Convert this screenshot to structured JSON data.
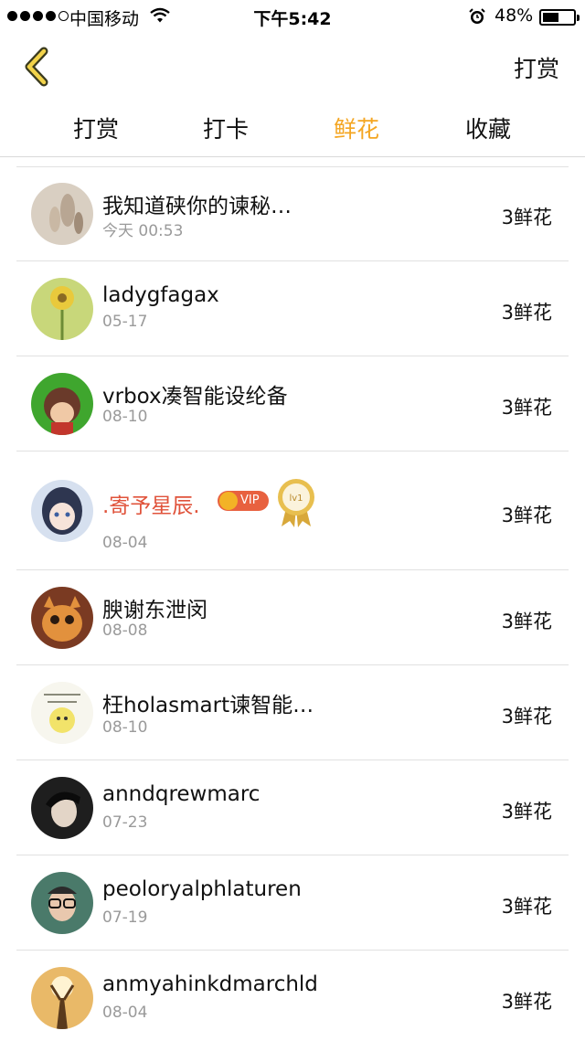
{
  "status_bar": {
    "carrier": "中国移动",
    "time": "下午5:42",
    "battery": "48%"
  },
  "nav": {
    "right_label": "打赏"
  },
  "tabs": [
    {
      "label": "打赏",
      "active": false
    },
    {
      "label": "打卡",
      "active": false
    },
    {
      "label": "鲜花",
      "active": true
    },
    {
      "label": "收藏",
      "active": false
    }
  ],
  "colors": {
    "accent": "#f4a622",
    "vip_name": "#e0533b"
  },
  "list": [
    {
      "name": "我知道硖你的谏秘…",
      "date": "今天 00:53",
      "count": "3鲜花"
    },
    {
      "name": "ladygfagax",
      "date": "05-17",
      "count": "3鲜花"
    },
    {
      "name": "vrbox凑智能设纶备",
      "date": "08-10",
      "count": "3鲜花"
    },
    {
      "name": ".寄予星辰.",
      "date": "08-04",
      "count": "3鲜花",
      "vip": true,
      "vip_label": "VIP",
      "medal_label": "lv1"
    },
    {
      "name": "腴谢东泄闵",
      "date": "08-08",
      "count": "3鲜花"
    },
    {
      "name": "枉holasmart谏智能…",
      "date": "08-10",
      "count": "3鲜花"
    },
    {
      "name": "anndqrewmarc",
      "date": "07-23",
      "count": "3鲜花"
    },
    {
      "name": "peoloryalphlaturen",
      "date": "07-19",
      "count": "3鲜花"
    },
    {
      "name": "anmyahinkdmarchld",
      "date": "08-04",
      "count": "3鲜花"
    }
  ]
}
